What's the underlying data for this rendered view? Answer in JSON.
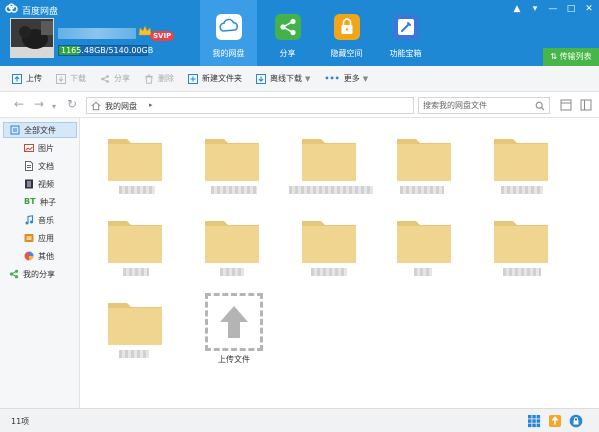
{
  "app": {
    "title": "百度网盘"
  },
  "window": {
    "controls": [
      "bell",
      "settings",
      "minimize",
      "maximize",
      "close"
    ]
  },
  "user": {
    "vip_label": "SVIP",
    "storage_used": "1165.48GB",
    "storage_total": "5140.00GB",
    "storage_text": "1165.48GB/5140.00GB",
    "storage_fraction": 0.227
  },
  "main_nav": [
    {
      "label": "我的网盘",
      "icon": "cloud-icon",
      "active": true,
      "color": "#2a8ee0"
    },
    {
      "label": "分享",
      "icon": "share-nodes-icon",
      "active": false,
      "color": "#44b24a"
    },
    {
      "label": "隐藏空间",
      "icon": "lock-icon",
      "active": false,
      "color": "#f0a619"
    },
    {
      "label": "功能宝箱",
      "icon": "toolbox-icon",
      "active": false,
      "color": "#3a78d8"
    }
  ],
  "transfer_list": "传输列表",
  "toolbar": {
    "upload": "上传",
    "download": "下载",
    "share": "分享",
    "delete": "删除",
    "new_folder": "新建文件夹",
    "offline_download": "离线下载",
    "more": "更多"
  },
  "address": {
    "crumb": "我的网盘",
    "search_placeholder": "搜索我的网盘文件"
  },
  "sidebar": [
    {
      "label": "全部文件",
      "icon": "all-files-icon",
      "active": true
    },
    {
      "label": "图片",
      "icon": "image-icon",
      "active": false
    },
    {
      "label": "文档",
      "icon": "document-icon",
      "active": false
    },
    {
      "label": "视频",
      "icon": "video-icon",
      "active": false
    },
    {
      "label": "种子",
      "icon": "bt-icon",
      "active": false
    },
    {
      "label": "音乐",
      "icon": "music-icon",
      "active": false
    },
    {
      "label": "应用",
      "icon": "app-icon",
      "active": false
    },
    {
      "label": "其他",
      "icon": "other-icon",
      "active": false
    },
    {
      "label": "我的分享",
      "icon": "my-share-icon",
      "active": false
    }
  ],
  "upload_tile": {
    "label": "上传文件"
  },
  "status": {
    "item_count": "11项"
  },
  "colors": {
    "header": "#1e88d4",
    "folder": "#f0d591",
    "folder_dark": "#e6c77a",
    "accent_green": "#47b549"
  }
}
